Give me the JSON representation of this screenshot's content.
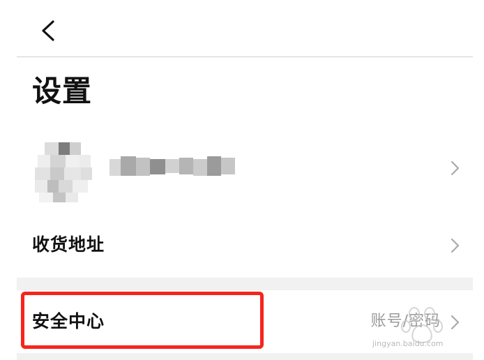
{
  "header": {
    "back_icon": "chevron-left-icon"
  },
  "page": {
    "title": "设置"
  },
  "profile": {
    "avatar": "avatar-blurred",
    "nickname": "",
    "chevron_icon": "chevron-right-icon"
  },
  "rows": {
    "address": {
      "label": "收货地址",
      "chevron_icon": "chevron-right-icon"
    },
    "security": {
      "label": "安全中心",
      "value": "账号/密码",
      "chevron_icon": "chevron-right-icon"
    }
  },
  "annotation": {
    "highlight_color": "#f5251c"
  },
  "watermark": {
    "text": "jingyan.baidu.com"
  },
  "colors": {
    "divider": "#cfcfcf",
    "section_gap": "#f1f1f1",
    "secondary_text": "#9a9a9a"
  }
}
